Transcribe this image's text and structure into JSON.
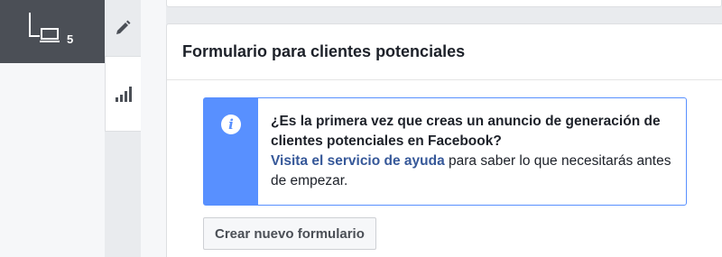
{
  "nav": {
    "selected_count": "5"
  },
  "tools": [
    {
      "icon": "pencil-icon"
    },
    {
      "icon": "bar-chart-icon"
    }
  ],
  "section": {
    "title": "Formulario para clientes potenciales",
    "info": {
      "icon": "info-icon",
      "question": "¿Es la primera vez que creas un anuncio de generación de clientes potenciales en Facebook?",
      "link_text": "Visita el servicio de ayuda",
      "after_link": " para saber lo que necesitarás antes de empezar."
    },
    "create_button_label": "Crear nuevo formulario"
  },
  "colors": {
    "accent": "#5890ff",
    "link": "#365899",
    "nav_dark": "#4b4f56"
  }
}
